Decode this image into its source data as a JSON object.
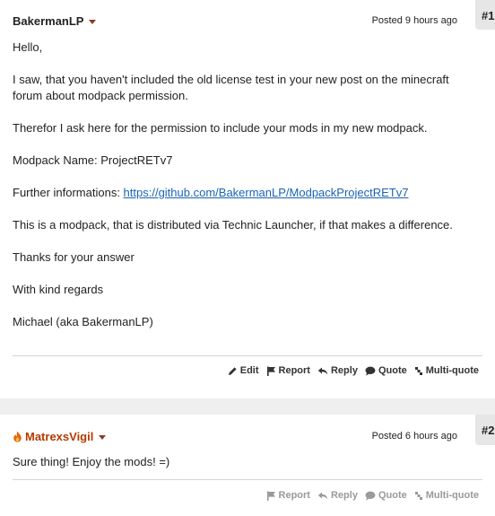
{
  "posts": [
    {
      "number": "#1",
      "username": "BakermanLP",
      "posted": "Posted 9 hours ago",
      "body": {
        "greeting": "Hello,",
        "p1": "I saw, that you haven't included the old license test in your new post on the minecraft forum about modpack permission.",
        "p2": "Therefor I ask here for the permission to include your mods in my new modpack.",
        "p3": "Modpack Name: ProjectRETv7",
        "p4_label": "Further informations: ",
        "p4_link": "https://github.com/BakermanLP/ModpackProjectRETv7",
        "p5": "This is a modpack, that is distributed via Technic Launcher, if that makes a difference.",
        "p6": "Thanks for your answer",
        "p7": "With kind regards",
        "p8": "Michael (aka BakermanLP)"
      },
      "actions": {
        "edit": "Edit",
        "report": "Report",
        "reply": "Reply",
        "quote": "Quote",
        "multiquote": "Multi-quote"
      }
    },
    {
      "number": "#2",
      "username": "MatrexsVigil",
      "user_icon": "flame-icon",
      "posted": "Posted 6 hours ago",
      "body": {
        "p1": "Sure thing! Enjoy the mods! =)"
      },
      "actions": {
        "report": "Report",
        "reply": "Reply",
        "quote": "Quote",
        "multiquote": "Multi-quote"
      }
    }
  ],
  "colors": {
    "link": "#1a64b3",
    "mod_username": "#b43a00",
    "caret": "#8a3a2a",
    "disabled_action": "#9a9a9a"
  }
}
